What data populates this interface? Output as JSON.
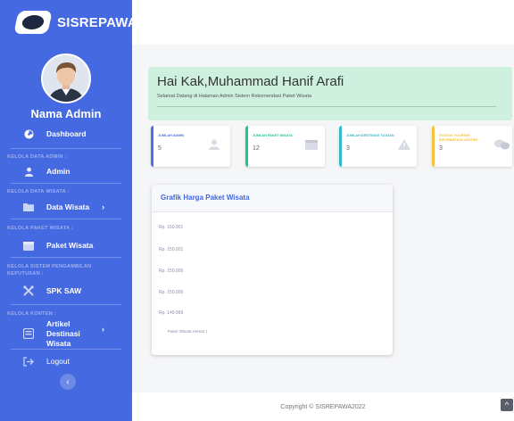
{
  "sidebar": {
    "brand": "SISREPAWA",
    "admin_name": "Nama Admin",
    "dashboard": "Dashboard",
    "section_admin": "KELOLA DATA ADMIN :",
    "admin": "Admin",
    "section_wisata": "KELOLA DATA WISATA :",
    "data_wisata": "Data Wisata",
    "section_paket": "KELOLA PAKET WISATA :",
    "paket_wisata": "Paket Wisata",
    "section_spk": "KELOLA SISTEM PENGAMBILAN KEPUTUSAN :",
    "spk_saw": "SPK SAW",
    "section_konten": "KELOLA KONTEN :",
    "artikel": "Artikel Destinasi Wisata",
    "logout": "Logout",
    "chevron": "›",
    "collapse_icon": "‹"
  },
  "welcome": {
    "title": "Hai Kak,Muhammad Hanif Arafi",
    "subtitle": "Selamat Datang di Halaman Admin Sistem Rekomendasi Paket Wisata"
  },
  "cards": [
    {
      "label": "JUMLAH ADMIN",
      "value": "5",
      "color": "#4e73df",
      "icon": "user-icon"
    },
    {
      "label": "JUMLAH PAKET WISATA",
      "value": "12",
      "color": "#1cc88a",
      "icon": "calendar-icon"
    },
    {
      "label": "JUMLAH DESTINASI TUJUAN",
      "value": "3",
      "color": "#36b9cc",
      "icon": "warning-icon"
    },
    {
      "label": "KONTAK TOURISM INFORMATION CENTER",
      "value": "3",
      "color": "#f6c23e",
      "icon": "chat-icon"
    }
  ],
  "chart": {
    "title": "Grafik Harga Paket Wisata",
    "ticks": [
      "Rp. 150,001",
      "Rp. 150,001",
      "Rp. 150,000",
      "Rp. 150,000",
      "Rp. 149,999"
    ],
    "legend": "Paket Wisata Hemat 1"
  },
  "chart_data": {
    "type": "line",
    "title": "Grafik Harga Paket Wisata",
    "y_tick_labels": [
      "Rp. 150,001",
      "Rp. 150,001",
      "Rp. 150,000",
      "Rp. 150,000",
      "Rp. 149,999"
    ],
    "series": [
      {
        "name": "Paket Wisata Hemat 1",
        "values": []
      }
    ],
    "legend_position": "bottom-left"
  },
  "footer": {
    "copyright": "Copyright © SISREPAWA2022",
    "scroll_top_icon": "^"
  }
}
